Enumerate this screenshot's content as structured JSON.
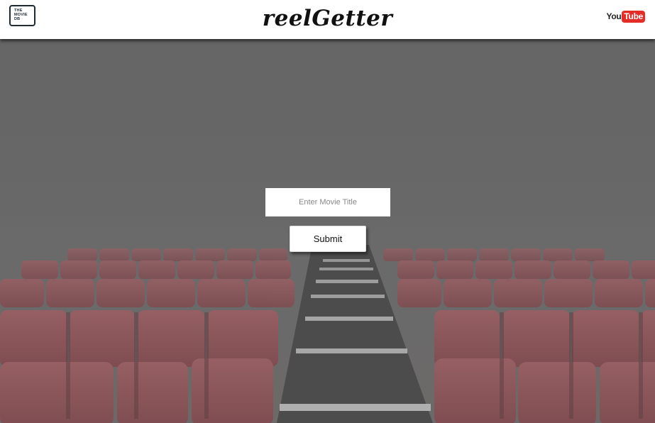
{
  "header": {
    "tmdb_logo_lines": [
      "THE",
      "MOVIE",
      "DB"
    ],
    "title": "reelGetter",
    "youtube_you": "You",
    "youtube_tube": "Tube"
  },
  "search": {
    "placeholder": "Enter Movie Title",
    "value": "",
    "submit_label": "Submit"
  },
  "colors": {
    "header_bg": "#ffffff",
    "overlay": "#6a6a6a",
    "seat_red": "#a44b52",
    "youtube_red": "#e52d27"
  },
  "icons": {
    "left_logo": "the-movie-db-logo",
    "right_logo": "youtube-logo"
  }
}
